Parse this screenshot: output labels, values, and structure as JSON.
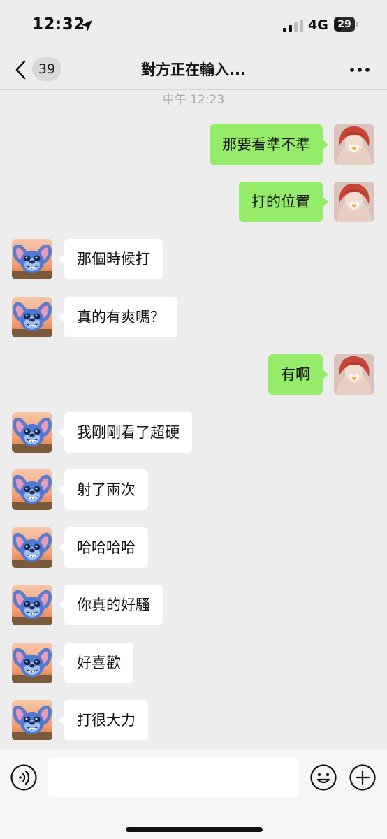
{
  "status_bar": {
    "time": "12:32",
    "network": "4G",
    "battery": "29"
  },
  "nav": {
    "unread_count": "39",
    "title": "對方正在輸入..."
  },
  "time_divider": "中午 12:23",
  "messages": [
    {
      "side": "out",
      "text": "那要看準不準"
    },
    {
      "side": "out",
      "text": "打的位置"
    },
    {
      "side": "in",
      "text": "那個時候打"
    },
    {
      "side": "in",
      "text": "真的有爽嗎？"
    },
    {
      "side": "out",
      "text": "有啊"
    },
    {
      "side": "in",
      "text": "我剛剛看了超硬"
    },
    {
      "side": "in",
      "text": "射了兩次"
    },
    {
      "side": "in",
      "text": "哈哈哈哈"
    },
    {
      "side": "in",
      "text": "你真的好騷"
    },
    {
      "side": "in",
      "text": "好喜歡"
    },
    {
      "side": "in",
      "text": "打很大力"
    }
  ],
  "input": {
    "value": "",
    "placeholder": ""
  },
  "icons": {
    "back": "chevron-left-icon",
    "more": "more-dots-icon",
    "voice": "voice-icon",
    "emoji": "emoji-icon",
    "plus": "plus-icon",
    "location": "location-arrow-icon",
    "signal": "signal-icon"
  },
  "colors": {
    "outgoing_bubble": "#95ec69",
    "incoming_bubble": "#ffffff",
    "background": "#ededed"
  }
}
